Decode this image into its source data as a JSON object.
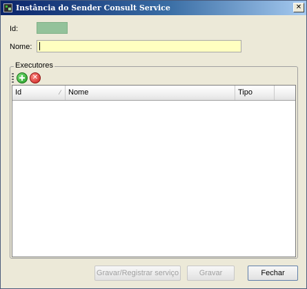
{
  "window": {
    "title": "Instância do Sender Consult Service",
    "close_symbol": "✕"
  },
  "form": {
    "id_label": "Id:",
    "id_value": "",
    "name_label": "Nome:",
    "name_value": ""
  },
  "executors": {
    "group_label": "Executores",
    "toolbar": {
      "add_icon": "add-circle-icon",
      "remove_icon": "remove-circle-icon",
      "remove_symbol": "✕"
    },
    "columns": [
      "Id",
      "Nome",
      "Tipo"
    ],
    "rows": []
  },
  "buttons": {
    "register_label": "Gravar/Registrar serviço",
    "save_label": "Gravar",
    "close_label": "Fechar"
  },
  "colors": {
    "input_bg": "#ffffc0",
    "id_bg": "#93c29a",
    "title_gradient_start": "#0a246a"
  }
}
